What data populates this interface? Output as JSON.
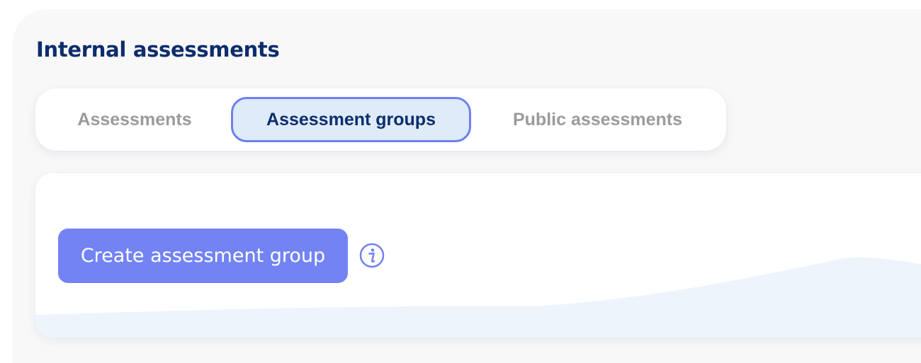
{
  "header": {
    "title": "Internal assessments"
  },
  "tabs": [
    {
      "label": "Assessments",
      "active": false
    },
    {
      "label": "Assessment groups",
      "active": true
    },
    {
      "label": "Public assessments",
      "active": false
    }
  ],
  "main": {
    "create_button_label": "Create assessment group",
    "info_icon": "info-icon"
  },
  "colors": {
    "title": "#0d2d6c",
    "accent": "#7383f4",
    "active_tab_bg": "#deebf8",
    "active_tab_border": "#6f7ff0",
    "inactive_tab_text": "#9b9b9b",
    "wave_fill": "#eef4fc"
  }
}
